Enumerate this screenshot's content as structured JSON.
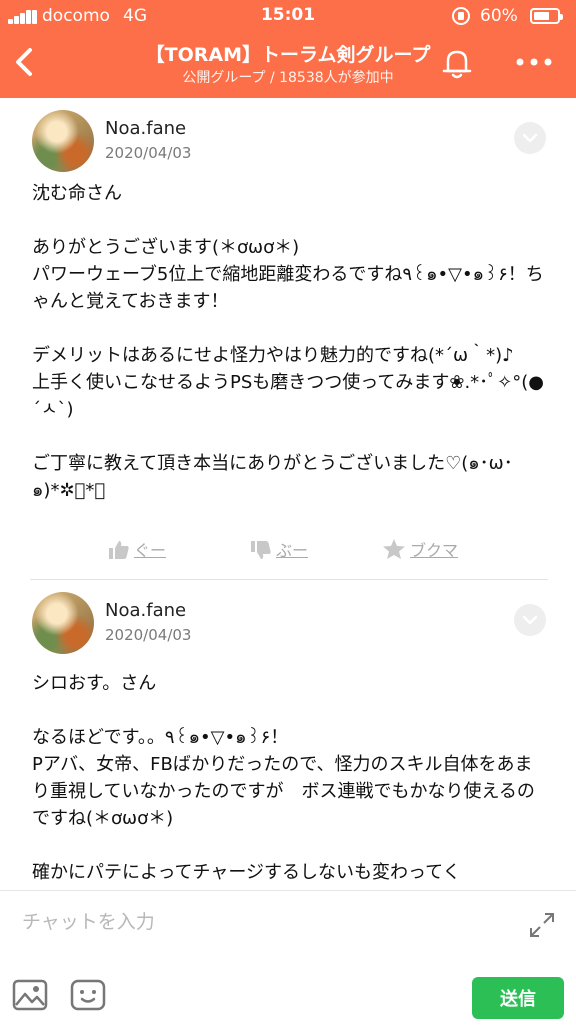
{
  "status_bar": {
    "carrier": "docomo",
    "network": "4G",
    "time": "15:01",
    "battery": "60%",
    "battery_level": 0.6
  },
  "header": {
    "title": "【TORAM】トーラム剣グループ",
    "subtitle": "公開グループ / 18538人が参加中",
    "icons": [
      "back-chevron-icon",
      "bell-icon",
      "more-dots-icon"
    ]
  },
  "posts": [
    {
      "author": "Noa.fane",
      "date": "2020/04/03",
      "paragraphs": [
        "沈む命さん",
        "ありがとうございます(＊ơωơ＊)\nパワーウェーブ5位上で縮地距離変わるですね٩꒰๑•▽•๑꒱۶！ちゃんと覚えておきます！",
        "デメリットはあるにせよ怪力やはり魅力的ですね(*´ω｀*)♪\n上手く使いこなせるようPSも磨きつつ使ってみます❀.*･ﾟ✧°(●´ㅅ`)",
        "ご丁寧に教えて頂き本当にありがとうございました♡(๑･ω･๑)*✲ﾟ*。"
      ],
      "actions": {
        "like": "ぐー",
        "dislike": "ぶー",
        "bookmark": "ブクマ"
      }
    },
    {
      "author": "Noa.fane",
      "date": "2020/04/03",
      "paragraphs": [
        "シロおす。さん",
        "なるほどです。。٩꒰๑•▽•๑꒱۶！\nPアバ、女帝、FBばかりだったので、怪力のスキル自体をあまり重視していなかったのですが　ボス連戦でもかなり使えるのですね(＊ơωơ＊)",
        "確かにパテによってチャージするしないも変わってく"
      ]
    }
  ],
  "composer": {
    "placeholder": "チャットを入力",
    "send_label": "送信",
    "send_color": "#2bbf55"
  },
  "colors": {
    "header": "#fc6f48",
    "send": "#2bbf55"
  }
}
